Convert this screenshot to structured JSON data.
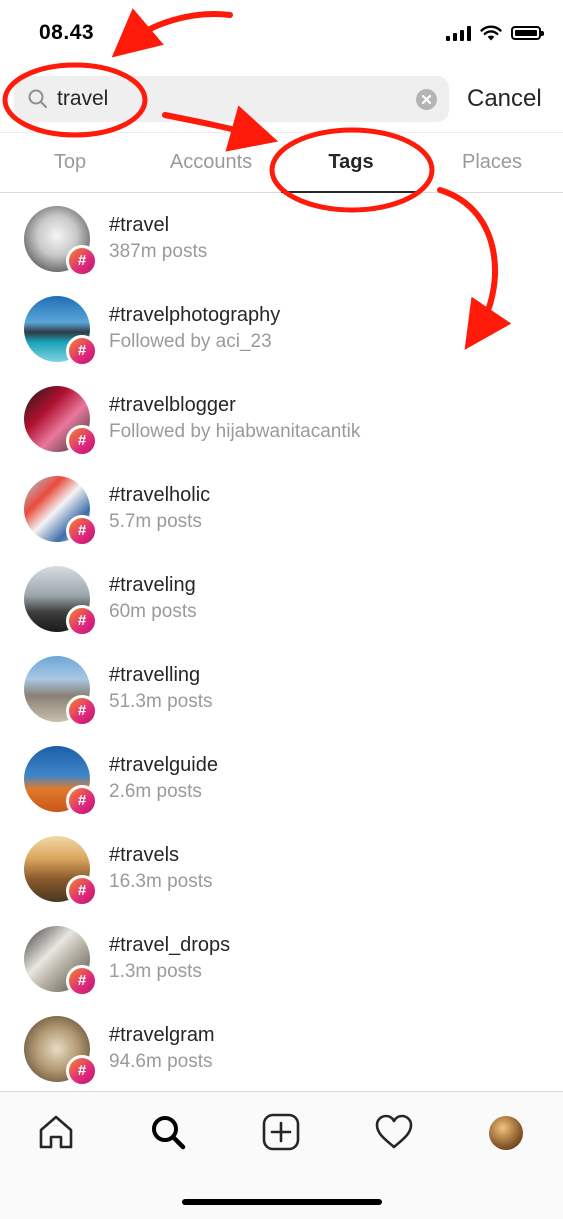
{
  "status_bar": {
    "time": "08.43",
    "signal_icon": "signal-icon",
    "wifi_icon": "wifi-icon",
    "battery_icon": "battery-icon"
  },
  "search": {
    "query": "travel",
    "cancel_label": "Cancel"
  },
  "tabs": [
    {
      "label": "Top",
      "active": false
    },
    {
      "label": "Accounts",
      "active": false
    },
    {
      "label": "Tags",
      "active": true
    },
    {
      "label": "Places",
      "active": false
    }
  ],
  "results": [
    {
      "tag": "#travel",
      "subtitle": "387m posts"
    },
    {
      "tag": "#travelphotography",
      "subtitle": "Followed by aci_23"
    },
    {
      "tag": "#travelblogger",
      "subtitle": "Followed by hijabwanitacantik"
    },
    {
      "tag": "#travelholic",
      "subtitle": "5.7m posts"
    },
    {
      "tag": "#traveling",
      "subtitle": "60m posts"
    },
    {
      "tag": "#travelling",
      "subtitle": "51.3m posts"
    },
    {
      "tag": "#travelguide",
      "subtitle": "2.6m posts"
    },
    {
      "tag": "#travels",
      "subtitle": "16.3m posts"
    },
    {
      "tag": "#travel_drops",
      "subtitle": "1.3m posts"
    },
    {
      "tag": "#travelgram",
      "subtitle": "94.6m posts"
    }
  ],
  "badge_symbol": "#",
  "bottom_nav": [
    "home-icon",
    "search-icon",
    "new-post-icon",
    "activity-heart-icon",
    "profile-avatar"
  ],
  "colors": {
    "annotation": "#ff1a0a",
    "badge_gradient": [
      "#f58529",
      "#dd2a7b"
    ],
    "muted_text": "#9a9a9a"
  }
}
